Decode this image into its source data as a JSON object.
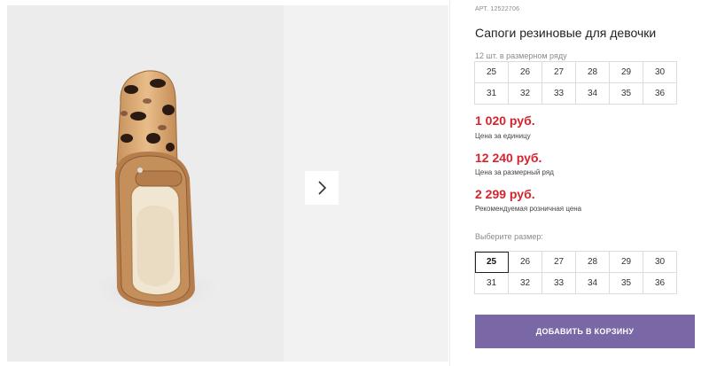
{
  "product": {
    "article": "АРТ. 12522706",
    "title": "Сапоги резиновые для девочки",
    "row_note": "12 шт. в размерном ряду"
  },
  "size_row": [
    "25",
    "26",
    "27",
    "28",
    "29",
    "30",
    "31",
    "32",
    "33",
    "34",
    "35",
    "36"
  ],
  "prices": [
    {
      "value": "1 020 руб.",
      "label": "Цена за единицу"
    },
    {
      "value": "12 240 руб.",
      "label": "Цена за размерный ряд"
    },
    {
      "value": "2 299 руб.",
      "label": "Рекомендуемая розничная цена"
    }
  ],
  "size_picker": {
    "label": "Выберите размер:",
    "options": [
      "25",
      "26",
      "27",
      "28",
      "29",
      "30",
      "31",
      "32",
      "33",
      "34",
      "35",
      "36"
    ],
    "selected": "25"
  },
  "cart_button": "Добавить в корзину",
  "gallery": {
    "next_icon": "chevron-right-icon"
  },
  "colors": {
    "price": "#d4252f",
    "button": "#7a68a6"
  }
}
